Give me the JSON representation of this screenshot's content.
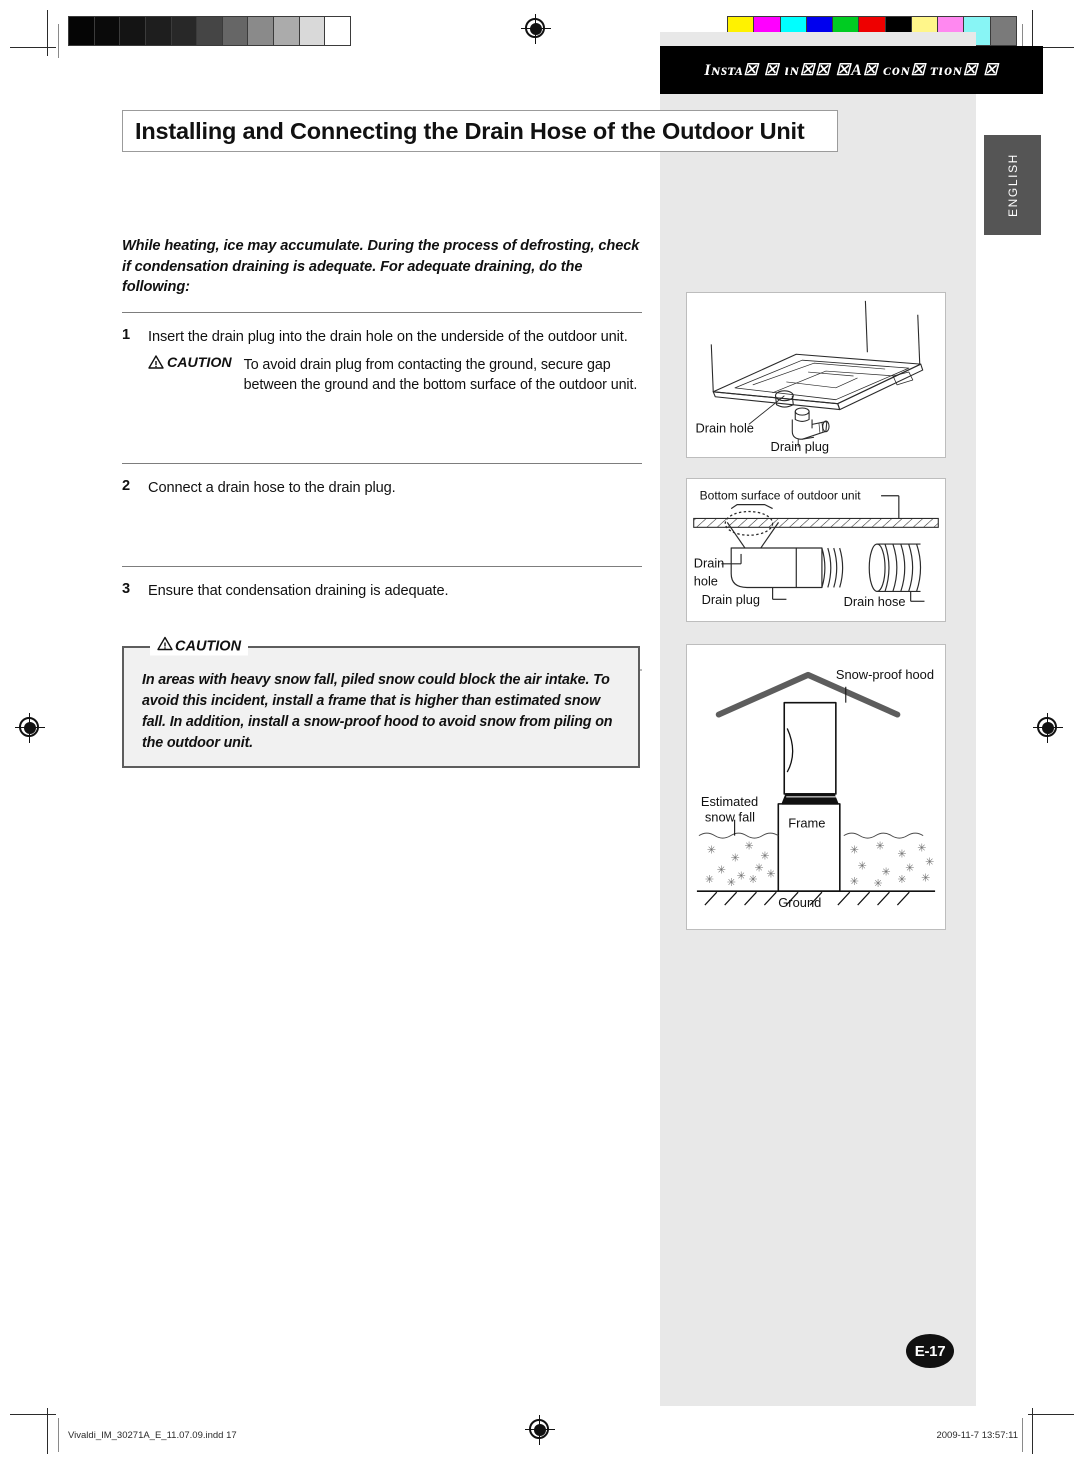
{
  "running_head": {
    "text": "Iɴsᴛᴀ☒ ☒  ɪɴ☒☒ ☒A☒ ᴄᴏɴ☒ ᴛɪᴏɴ☒ ☒",
    "plain": "INSTALLING THE AIR CONDITIONER"
  },
  "language_tab": {
    "label": "ENGLISH"
  },
  "page_title": "Installing and Connecting the Drain Hose of the Outdoor Unit",
  "intro": "While heating, ice may accumulate. During the process of defrosting, check if condensation draining is adequate.  For adequate draining, do the following:",
  "steps": [
    {
      "number": "1",
      "text": "Insert the drain plug into the drain hole on the underside of the outdoor unit.",
      "caution_label": "CAUTION",
      "caution_text": "To avoid drain plug from contacting the ground, secure gap between the ground and the bottom surface of the outdoor unit."
    },
    {
      "number": "2",
      "text": "Connect a drain hose to the drain plug."
    },
    {
      "number": "3",
      "text": "Ensure that condensation draining is adequate."
    }
  ],
  "caution_box": {
    "legend": "CAUTION",
    "text": "In areas with heavy snow fall, piled snow could block the air intake. To avoid this incident, install a frame that is higher than estimated snow fall. In addition, install a snow-proof hood to avoid snow from piling on the outdoor unit."
  },
  "figures": [
    {
      "id": "outdoor-unit-underside",
      "labels": [
        "Drain hole",
        "Drain plug"
      ]
    },
    {
      "id": "drain-plug-and-hose",
      "labels": [
        "Bottom surface of outdoor unit",
        "Drain",
        "hole",
        "Drain plug",
        "Drain hose"
      ]
    },
    {
      "id": "snow-proof-hood",
      "labels": [
        "Snow-proof hood",
        "Estimated",
        "snow fall",
        "Frame",
        "Ground"
      ]
    }
  ],
  "page_badge": "E-17",
  "footer": {
    "left": "Vivaldi_IM_30271A_E_11.07.09.indd   17",
    "right": "2009-11-7   13:57:11"
  },
  "calibration": {
    "grayscale": [
      "#050505",
      "#0a0a0a",
      "#141414",
      "#1e1e1e",
      "#282828",
      "#454545",
      "#666666",
      "#8a8a8a",
      "#ababab",
      "#d9d9d9",
      "#ffffff"
    ],
    "colors": [
      "#fff200",
      "#ff00ff",
      "#00ffff",
      "#0000ee",
      "#00cc22",
      "#ee0000",
      "#000000",
      "#fff68a",
      "#ff88f0",
      "#88f5f5",
      "#7a7a7a"
    ]
  },
  "theme": {
    "gray_column": "#e8e8e8",
    "banner": "#000000",
    "tab": "#555555",
    "caution_fill": "#f1f1f1"
  }
}
